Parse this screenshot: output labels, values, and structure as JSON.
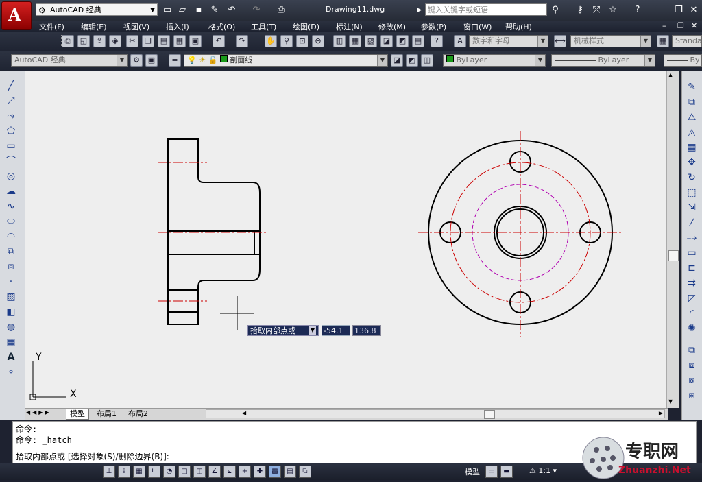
{
  "titlebar": {
    "workspace": "AutoCAD 经典",
    "document_title": "Drawing11.dwg",
    "search_placeholder": "键入关键字或短语"
  },
  "menu": [
    "文件(F)",
    "编辑(E)",
    "视图(V)",
    "插入(I)",
    "格式(O)",
    "工具(T)",
    "绘图(D)",
    "标注(N)",
    "修改(M)",
    "参数(P)",
    "窗口(W)",
    "帮助(H)"
  ],
  "toolbar2": {
    "text_style": "数字和字母",
    "dim_style": "机械样式",
    "table_style": "Standa"
  },
  "toolbar3": {
    "workspace": "AutoCAD 经典",
    "layer": "剖面线",
    "color": "ByLayer",
    "linetype": "ByLayer",
    "lineweight": "By"
  },
  "ucs": {
    "x_label": "X",
    "y_label": "Y"
  },
  "tabs": [
    "模型",
    "布局1",
    "布局2"
  ],
  "dynamic_input": {
    "prompt": "拾取内部点或",
    "x_value": "-54.1",
    "y_value": "136.8"
  },
  "command": {
    "line1": "命令:",
    "line2": "命令: _hatch",
    "line3": "拾取内部点或 [选择对象(S)/删除边界(B)]:"
  },
  "status": {
    "model_label": "模型",
    "scale": "1:1"
  },
  "watermark": {
    "text": "专职网",
    "url": "Zhuanzhi.Net"
  },
  "colors": {
    "object_line": "#000000",
    "center_line": "#cc0000",
    "hidden_circle": "#b000b0",
    "canvas_bg": "#eeeeee",
    "dynamic_input_bg": "#1c2a55"
  }
}
